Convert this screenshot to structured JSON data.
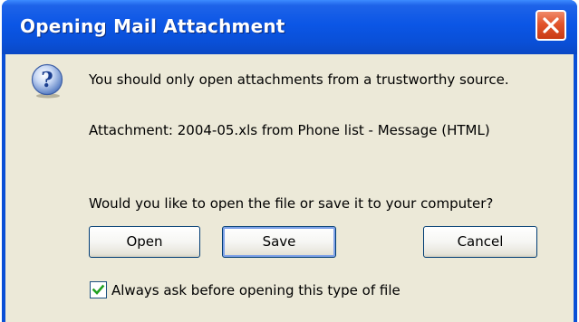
{
  "window": {
    "title": "Opening Mail Attachment",
    "close_icon": "close-icon"
  },
  "content": {
    "icon": "question-icon",
    "warning_text": "You should only open attachments from a trustworthy source.",
    "attachment_text": "Attachment: 2004-05.xls from Phone list - Message (HTML)",
    "prompt_text": "Would you like to open the file or save it to your computer?"
  },
  "buttons": {
    "open_label": "Open",
    "save_label": "Save",
    "cancel_label": "Cancel"
  },
  "always_ask": {
    "label": "Always ask before opening this type of file",
    "checked": true
  },
  "colors": {
    "titlebar": "#0a4fd6",
    "dialog_background": "#ece9d8",
    "close_button": "#e2542c"
  }
}
